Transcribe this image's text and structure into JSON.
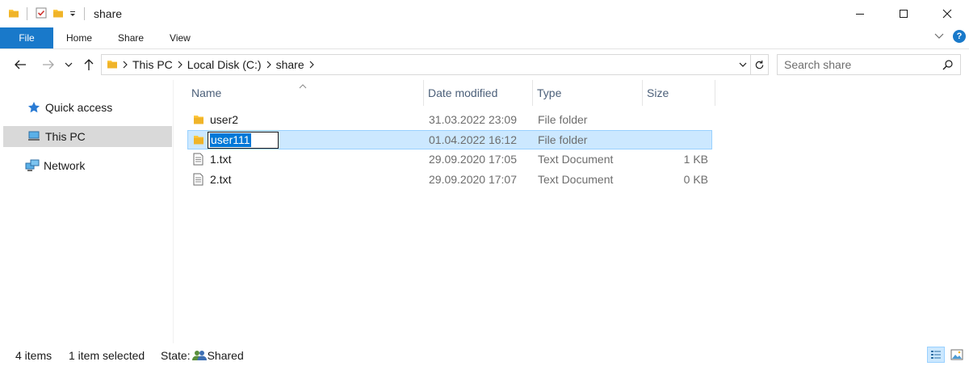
{
  "window": {
    "title": "share"
  },
  "ribbon": {
    "tabs": [
      {
        "label": "File"
      },
      {
        "label": "Home"
      },
      {
        "label": "Share"
      },
      {
        "label": "View"
      }
    ]
  },
  "address": {
    "crumbs": [
      {
        "label": "This PC"
      },
      {
        "label": "Local Disk (C:)"
      },
      {
        "label": "share"
      }
    ]
  },
  "search": {
    "placeholder": "Search share"
  },
  "navpane": {
    "items": [
      {
        "label": "Quick access",
        "icon": "star-icon"
      },
      {
        "label": "This PC",
        "icon": "computer-icon"
      },
      {
        "label": "Network",
        "icon": "network-icon"
      }
    ]
  },
  "filelist": {
    "columns": {
      "name": "Name",
      "date": "Date modified",
      "type": "Type",
      "size": "Size"
    },
    "rows": [
      {
        "name": "user2",
        "date": "31.03.2022 23:09",
        "type": "File folder",
        "size": "",
        "icon": "folder-icon"
      },
      {
        "name": "user111",
        "date": "01.04.2022 16:12",
        "type": "File folder",
        "size": "",
        "icon": "folder-icon"
      },
      {
        "name": "1.txt",
        "date": "29.09.2020 17:05",
        "type": "Text Document",
        "size": "1 KB",
        "icon": "text-file-icon"
      },
      {
        "name": "2.txt",
        "date": "29.09.2020 17:07",
        "type": "Text Document",
        "size": "0 KB",
        "icon": "text-file-icon"
      }
    ]
  },
  "status": {
    "items_count": "4 items",
    "selected": "1 item selected",
    "state_label": "State:",
    "state_value": "Shared"
  },
  "colors": {
    "accent": "#1979ca",
    "selection_bg": "#cce8ff",
    "selection_border": "#99d1ff",
    "folder": "#ffc83d"
  }
}
